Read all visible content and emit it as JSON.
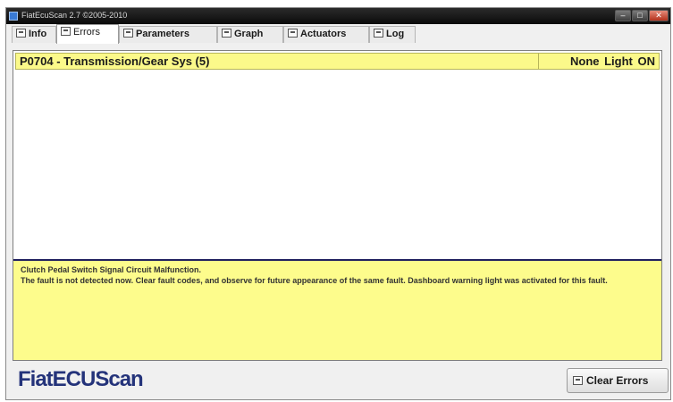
{
  "window": {
    "title": "FiatEcuScan 2.7 ©2005-2010"
  },
  "tabs": [
    {
      "label": "Info",
      "icon": "panel-icon"
    },
    {
      "label": "Errors",
      "icon": "panel-icon",
      "active": true
    },
    {
      "label": "Parameters",
      "icon": "panel-icon"
    },
    {
      "label": "Graph",
      "icon": "panel-icon"
    },
    {
      "label": "Actuators",
      "icon": "panel-icon"
    },
    {
      "label": "Log",
      "icon": "panel-icon"
    }
  ],
  "errors": [
    {
      "code_desc": "P0704 - Transmission/Gear Sys (5)",
      "status": "None  Light ON"
    }
  ],
  "description": {
    "line1": "Clutch Pedal Switch Signal Circuit Malfunction.",
    "line2": "The fault is not detected now. Clear fault codes, and observe for future appearance of the same fault. Dashboard warning light was activated for this fault."
  },
  "brand": "FiatECUScan",
  "buttons": {
    "clear_errors": "Clear Errors"
  },
  "colors": {
    "error_highlight": "#fbf98a",
    "description_bg": "#fdfc8c",
    "brand": "#24337a"
  }
}
